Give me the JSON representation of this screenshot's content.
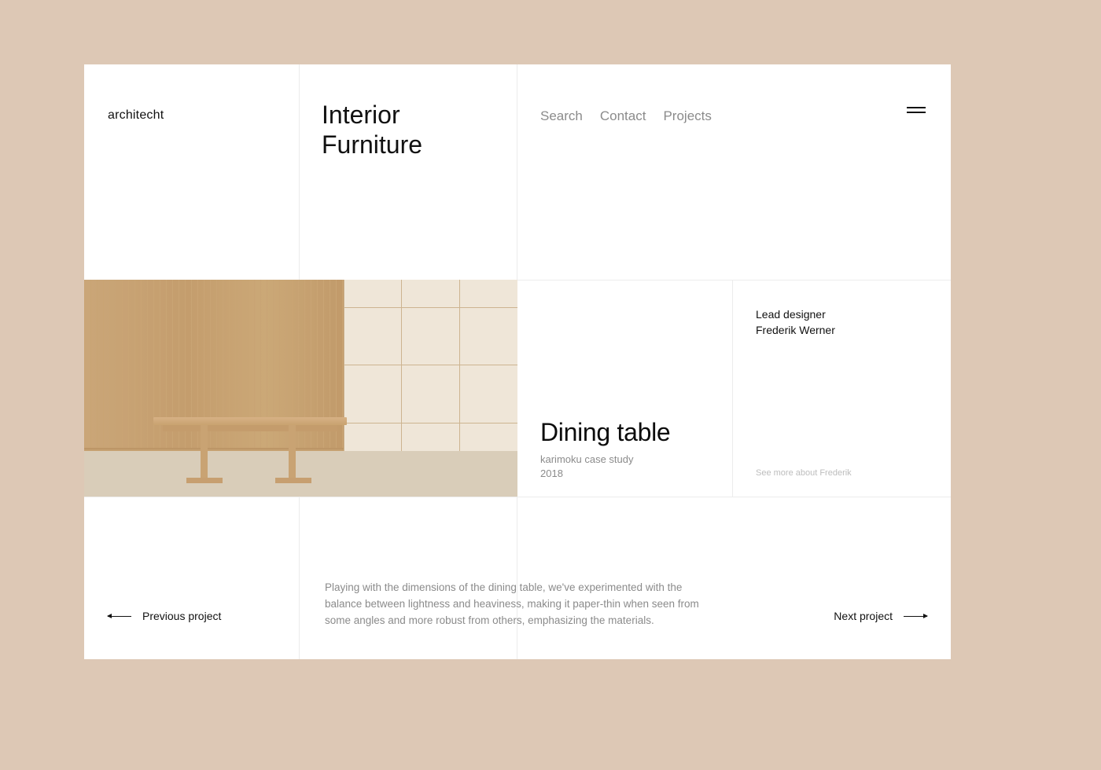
{
  "brand": "architecht",
  "page_title_line1": "Interior",
  "page_title_line2": "Furniture",
  "nav": {
    "search": "Search",
    "contact": "Contact",
    "projects": "Projects"
  },
  "product": {
    "title": "Dining table",
    "subtitle_line1": "karimoku case study",
    "subtitle_line2": "2018"
  },
  "designer": {
    "label": "Lead designer",
    "name": "Frederik Werner",
    "more": "See more about Frederik"
  },
  "description": "Playing with the dimensions of the dining table, we've experimented with the balance between lightness and heaviness, making it paper-thin when seen from some angles and more robust from others, emphasizing the materials.",
  "pager": {
    "prev": "Previous project",
    "next": "Next project"
  }
}
